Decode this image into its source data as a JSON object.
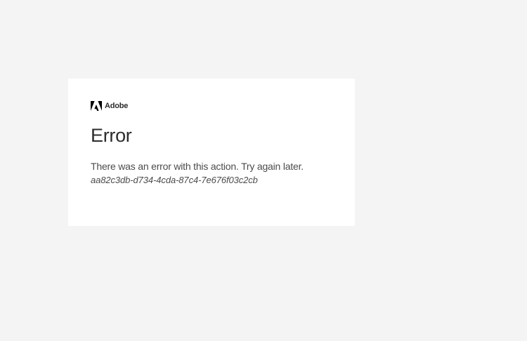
{
  "brand": {
    "name": "Adobe",
    "icon": "adobe-logo-icon",
    "color": "#000000"
  },
  "error": {
    "title": "Error",
    "message": "There was an error with this action. Try again later.",
    "id": "aa82c3db-d734-4cda-87c4-7e676f03c2cb"
  },
  "colors": {
    "page_background": "#f4f4f4",
    "card_background": "#ffffff",
    "text": "#2c2c2c"
  }
}
